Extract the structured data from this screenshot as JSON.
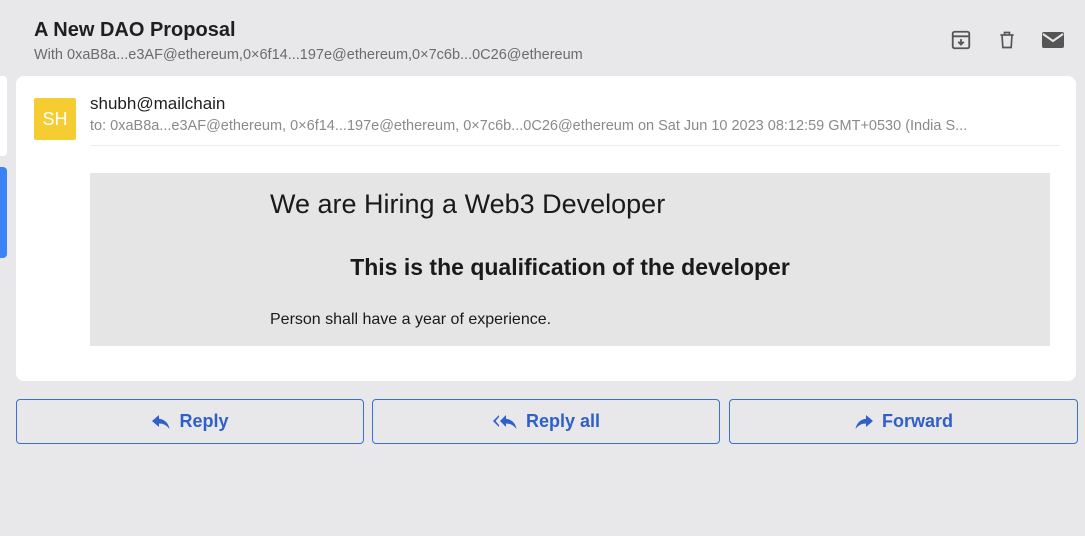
{
  "thread": {
    "subject": "A New DAO Proposal",
    "participants": "With 0xaB8a...e3AF@ethereum,0×6f14...197e@ethereum,0×7c6b...0C26@ethereum"
  },
  "header_actions": [
    "archive-icon",
    "trash-icon",
    "mail-icon"
  ],
  "message": {
    "avatar_initials": "SH",
    "sender": "shubh@mailchain",
    "recipients": "to: 0xaB8a...e3AF@ethereum, 0×6f14...197e@ethereum, 0×7c6b...0C26@ethereum on Sat Jun 10 2023 08:12:59 GMT+0530 (India S...",
    "body": {
      "heading": "We are Hiring a Web3 Developer",
      "subheading": "This is the qualification of the developer",
      "paragraph": "Person shall have a year of experience."
    }
  },
  "actions": {
    "reply": "Reply",
    "reply_all": "Reply all",
    "forward": "Forward"
  },
  "colors": {
    "accent": "#2f5fc9",
    "avatar": "#f5cd32",
    "background": "#e8e8ea"
  }
}
